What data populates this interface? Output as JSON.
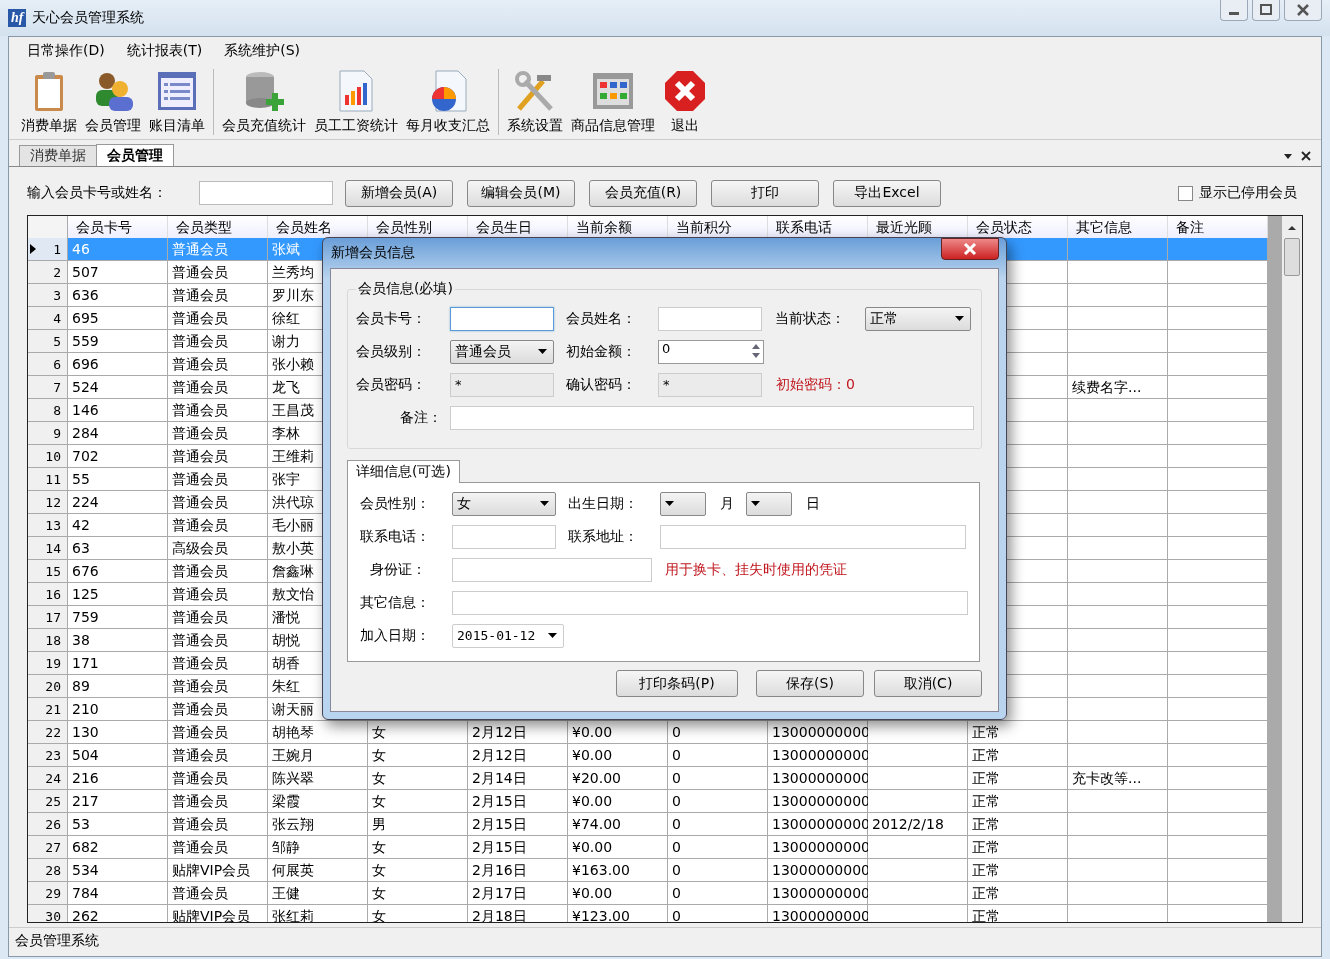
{
  "window": {
    "logo_text": "hf",
    "title": "天心会员管理系统"
  },
  "menu": [
    {
      "label": "日常操作(D)"
    },
    {
      "label": "统计报表(T)"
    },
    {
      "label": "系统维护(S)"
    }
  ],
  "toolbar": [
    [
      {
        "kind": "clipboard",
        "label": "消费单据"
      },
      {
        "kind": "users",
        "label": "会员管理"
      },
      {
        "kind": "list",
        "label": "账目清单"
      }
    ],
    [
      {
        "kind": "database",
        "label": "会员充值统计"
      },
      {
        "kind": "barchart",
        "label": "员工工资统计"
      },
      {
        "kind": "pie",
        "label": "每月收支汇总"
      }
    ],
    [
      {
        "kind": "tools",
        "label": "系统设置"
      },
      {
        "kind": "grid",
        "label": "商品信息管理"
      },
      {
        "kind": "exit",
        "label": "退出"
      }
    ]
  ],
  "tabs": [
    {
      "label": "消费单据",
      "selected": false
    },
    {
      "label": "会员管理",
      "selected": true
    }
  ],
  "search": {
    "label": "输入会员卡号或姓名：",
    "buttons": [
      "新增会员(A)",
      "编辑会员(M)",
      "会员充值(R)",
      "打印",
      "导出Excel"
    ],
    "show_disabled": {
      "label": "显示已停用会员",
      "checked": false
    }
  },
  "table": {
    "columns": [
      "会员卡号",
      "会员类型",
      "会员姓名",
      "会员性别",
      "会员生日",
      "当前余额",
      "当前积分",
      "联系电话",
      "最近光顾",
      "会员状态",
      "其它信息",
      "备注"
    ],
    "rows": [
      {
        "no": "1",
        "selected": true,
        "cells": [
          "46",
          "普通会员",
          "张斌",
          null,
          null,
          null,
          null,
          null,
          null,
          null,
          null,
          null
        ]
      },
      {
        "no": "2",
        "selected": false,
        "cells": [
          "507",
          "普通会员",
          "兰秀均",
          null,
          null,
          null,
          null,
          null,
          null,
          null,
          null,
          null
        ]
      },
      {
        "no": "3",
        "selected": false,
        "cells": [
          "636",
          "普通会员",
          "罗川东",
          null,
          null,
          null,
          null,
          null,
          null,
          null,
          null,
          null
        ]
      },
      {
        "no": "4",
        "selected": false,
        "cells": [
          "695",
          "普通会员",
          "徐红",
          null,
          null,
          null,
          null,
          null,
          null,
          null,
          null,
          null
        ]
      },
      {
        "no": "5",
        "selected": false,
        "cells": [
          "559",
          "普通会员",
          "谢力",
          null,
          null,
          null,
          null,
          null,
          null,
          null,
          null,
          null
        ]
      },
      {
        "no": "6",
        "selected": false,
        "cells": [
          "696",
          "普通会员",
          "张小赖",
          null,
          null,
          null,
          null,
          null,
          null,
          null,
          null,
          null
        ]
      },
      {
        "no": "7",
        "selected": false,
        "cells": [
          "524",
          "普通会员",
          "龙飞",
          null,
          null,
          null,
          null,
          null,
          null,
          null,
          "续费名字...",
          null
        ]
      },
      {
        "no": "8",
        "selected": false,
        "cells": [
          "146",
          "普通会员",
          "王昌茂",
          null,
          null,
          null,
          null,
          null,
          null,
          null,
          null,
          null
        ]
      },
      {
        "no": "9",
        "selected": false,
        "cells": [
          "284",
          "普通会员",
          "李林",
          null,
          null,
          null,
          null,
          null,
          null,
          null,
          null,
          null
        ]
      },
      {
        "no": "10",
        "selected": false,
        "cells": [
          "702",
          "普通会员",
          "王维莉",
          null,
          null,
          null,
          null,
          null,
          null,
          null,
          null,
          null
        ]
      },
      {
        "no": "11",
        "selected": false,
        "cells": [
          "55",
          "普通会员",
          "张宇",
          null,
          null,
          null,
          null,
          null,
          null,
          null,
          null,
          null
        ]
      },
      {
        "no": "12",
        "selected": false,
        "cells": [
          "224",
          "普通会员",
          "洪代琼",
          null,
          null,
          null,
          null,
          null,
          null,
          null,
          null,
          null
        ]
      },
      {
        "no": "13",
        "selected": false,
        "cells": [
          "42",
          "普通会员",
          "毛小丽",
          null,
          null,
          null,
          null,
          null,
          null,
          null,
          null,
          null
        ]
      },
      {
        "no": "14",
        "selected": false,
        "cells": [
          "63",
          "高级会员",
          "敖小英",
          null,
          null,
          null,
          null,
          null,
          null,
          null,
          null,
          null
        ]
      },
      {
        "no": "15",
        "selected": false,
        "cells": [
          "676",
          "普通会员",
          "詹鑫琳",
          null,
          null,
          null,
          null,
          null,
          null,
          null,
          null,
          null
        ]
      },
      {
        "no": "16",
        "selected": false,
        "cells": [
          "125",
          "普通会员",
          "敖文怡",
          null,
          null,
          null,
          null,
          null,
          null,
          null,
          null,
          null
        ]
      },
      {
        "no": "17",
        "selected": false,
        "cells": [
          "759",
          "普通会员",
          "潘悦",
          null,
          null,
          null,
          null,
          null,
          null,
          null,
          null,
          null
        ]
      },
      {
        "no": "18",
        "selected": false,
        "cells": [
          "38",
          "普通会员",
          "胡悦",
          null,
          null,
          null,
          null,
          null,
          null,
          null,
          null,
          null
        ]
      },
      {
        "no": "19",
        "selected": false,
        "cells": [
          "171",
          "普通会员",
          "胡香",
          null,
          null,
          null,
          null,
          null,
          null,
          null,
          null,
          null
        ]
      },
      {
        "no": "20",
        "selected": false,
        "cells": [
          "89",
          "普通会员",
          "朱红",
          null,
          null,
          null,
          null,
          null,
          null,
          null,
          null,
          null
        ]
      },
      {
        "no": "21",
        "selected": false,
        "cells": [
          "210",
          "普通会员",
          "谢天丽",
          null,
          null,
          null,
          null,
          null,
          null,
          null,
          null,
          null
        ]
      },
      {
        "no": "22",
        "selected": false,
        "cells": [
          "130",
          "普通会员",
          "胡艳琴",
          "女",
          "2月12日",
          "¥0.00",
          "0",
          "13000000000",
          null,
          "正常",
          null,
          null
        ]
      },
      {
        "no": "23",
        "selected": false,
        "cells": [
          "504",
          "普通会员",
          "王婉月",
          "女",
          "2月12日",
          "¥0.00",
          "0",
          "13000000000",
          null,
          "正常",
          null,
          null
        ]
      },
      {
        "no": "24",
        "selected": false,
        "cells": [
          "216",
          "普通会员",
          "陈兴翠",
          "女",
          "2月14日",
          "¥20.00",
          "0",
          "13000000000",
          null,
          "正常",
          "充卡改等...",
          null
        ]
      },
      {
        "no": "25",
        "selected": false,
        "cells": [
          "217",
          "普通会员",
          "梁霞",
          "女",
          "2月15日",
          "¥0.00",
          "0",
          "13000000000",
          null,
          "正常",
          null,
          null
        ]
      },
      {
        "no": "26",
        "selected": false,
        "cells": [
          "53",
          "普通会员",
          "张云翔",
          "男",
          "2月15日",
          "¥74.00",
          "0",
          "13000000000",
          "2012/2/18",
          "正常",
          null,
          null
        ]
      },
      {
        "no": "27",
        "selected": false,
        "cells": [
          "682",
          "普通会员",
          "邹静",
          "女",
          "2月15日",
          "¥0.00",
          "0",
          "13000000000",
          null,
          "正常",
          null,
          null
        ]
      },
      {
        "no": "28",
        "selected": false,
        "cells": [
          "534",
          "贴牌VIP会员",
          "何展英",
          "女",
          "2月16日",
          "¥163.00",
          "0",
          "13000000000",
          null,
          "正常",
          null,
          null
        ]
      },
      {
        "no": "29",
        "selected": false,
        "cells": [
          "784",
          "普通会员",
          "王健",
          "女",
          "2月17日",
          "¥0.00",
          "0",
          "13000000000",
          null,
          "正常",
          null,
          null
        ]
      },
      {
        "no": "30",
        "selected": false,
        "cells": [
          "262",
          "贴牌VIP会员",
          "张红莉",
          "女",
          "2月18日",
          "¥123.00",
          "0",
          "13000000000",
          null,
          "正常",
          null,
          null
        ]
      }
    ]
  },
  "status_bar": "会员管理系统",
  "dialog": {
    "title": "新增会员信息",
    "required_group": {
      "title": "会员信息(必填)",
      "card_label": "会员卡号：",
      "card_focused": true,
      "name_label": "会员姓名：",
      "state_label": "当前状态：",
      "state_value": "正常",
      "level_label": "会员级别：",
      "level_value": "普通会员",
      "amount_label": "初始金额：",
      "amount_value": "0",
      "password_label": "会员密码：",
      "password_value": "*",
      "confirm_label": "确认密码：",
      "confirm_value": "*",
      "password_note": "初始密码：0",
      "remark_label": "备注："
    },
    "detail_tab": {
      "title": "详细信息(可选)",
      "gender_label": "会员性别：",
      "gender_value": "女",
      "birth_label": "出生日期：",
      "month_label": "月",
      "day_label": "日",
      "phone_label": "联系电话：",
      "address_label": "联系地址：",
      "id_label": "身份证：",
      "id_note": "用于换卡、挂失时使用的凭证",
      "other_label": "其它信息：",
      "join_label": "加入日期：",
      "join_value": "2015-01-12"
    },
    "buttons": [
      "打印条码(P)",
      "保存(S)",
      "取消(C)"
    ]
  }
}
